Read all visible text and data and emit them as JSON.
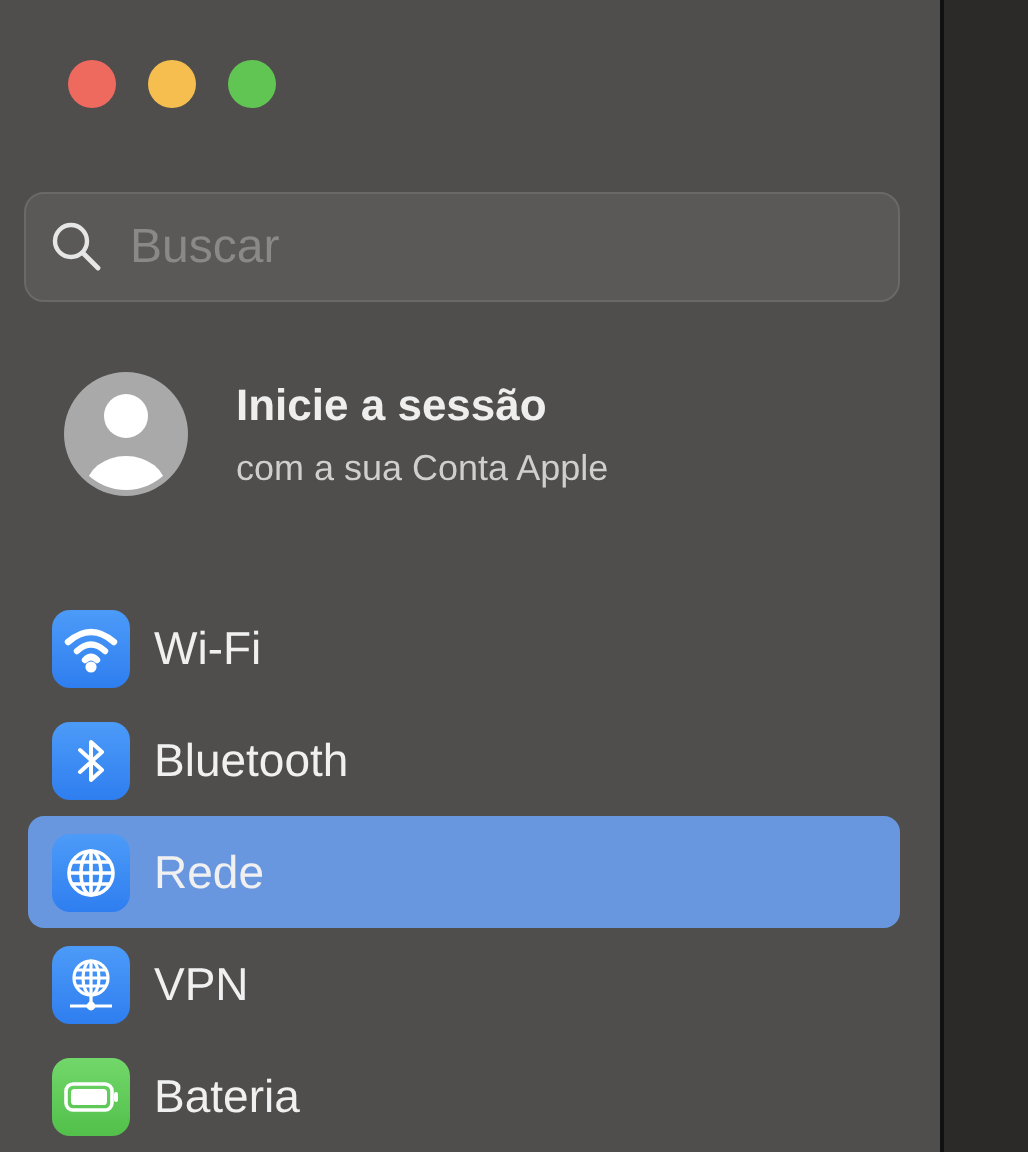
{
  "window_controls": [
    {
      "color": "#ee6a5f"
    },
    {
      "color": "#f5be4f"
    },
    {
      "color": "#61c554"
    }
  ],
  "search": {
    "placeholder": "Buscar"
  },
  "account": {
    "title": "Inicie a sessão",
    "subtitle": "com a sua Conta Apple"
  },
  "sidebar": {
    "items": [
      {
        "label": "Wi-Fi",
        "kind": "wifi",
        "selected": false
      },
      {
        "label": "Bluetooth",
        "kind": "bluetooth",
        "selected": false
      },
      {
        "label": "Rede",
        "kind": "network",
        "selected": true
      },
      {
        "label": "VPN",
        "kind": "vpn",
        "selected": false
      },
      {
        "label": "Bateria",
        "kind": "battery",
        "selected": false
      }
    ]
  }
}
